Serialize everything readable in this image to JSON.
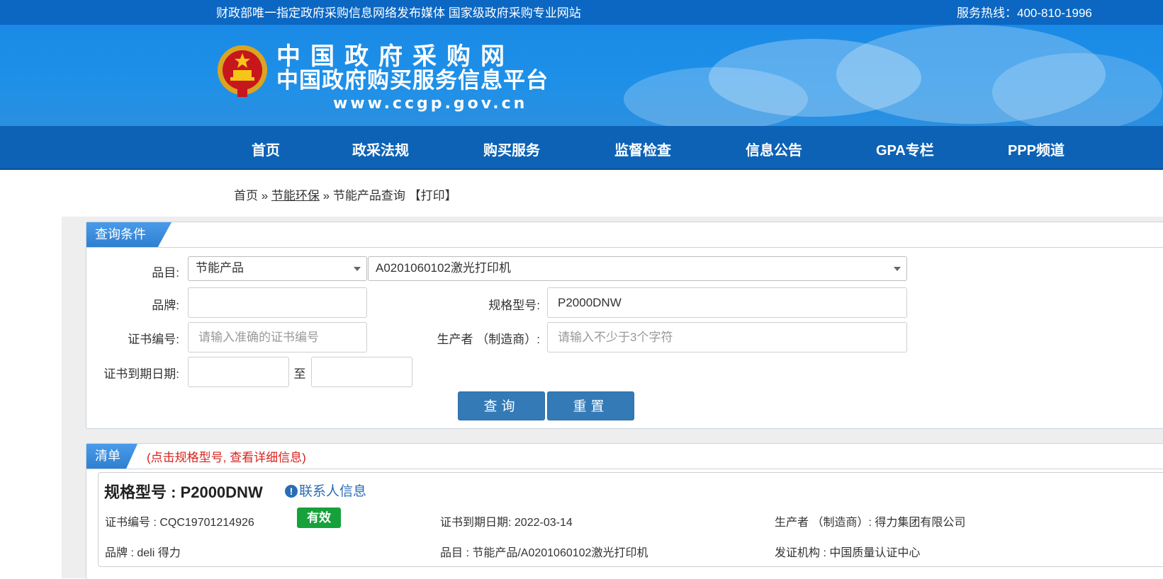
{
  "topbar": {
    "slogan": "财政部唯一指定政府采购信息网络发布媒体 国家级政府采购专业网站",
    "hotline": "服务热线：400-810-1996"
  },
  "banner": {
    "title_line1": "中国政府采购网",
    "title_line2": "中国政府购买服务信息平台",
    "url": "www.ccgp.gov.cn",
    "emblem_icon": "national-emblem-icon"
  },
  "nav": {
    "items": [
      {
        "label": "首页"
      },
      {
        "label": "政采法规"
      },
      {
        "label": "购买服务"
      },
      {
        "label": "监督检查"
      },
      {
        "label": "信息公告"
      },
      {
        "label": "GPA专栏"
      },
      {
        "label": "PPP频道"
      }
    ]
  },
  "breadcrumb": {
    "home": "首页",
    "sep1": "»",
    "section": "节能环保",
    "sep2": "»",
    "page": "节能产品查询",
    "print": "【打印】"
  },
  "query": {
    "tab": "查询条件",
    "category_label": "品目:",
    "category_value": "节能产品",
    "subcategory_value": "A0201060102激光打印机",
    "brand_label": "品牌:",
    "brand_value": "",
    "model_label": "规格型号:",
    "model_value": "P2000DNW",
    "cert_label": "证书编号:",
    "cert_placeholder": "请输入准确的证书编号",
    "maker_label": "生产者 （制造商）:",
    "maker_placeholder": "请输入不少于3个字符",
    "expiry_label": "证书到期日期:",
    "to_label": "至",
    "search_button": "查询",
    "reset_button": "重置"
  },
  "results": {
    "tab": "清单",
    "hint": "(点击规格型号, 查看详细信息)",
    "records": [
      {
        "model": "规格型号 : P2000DNW",
        "contact": "联系人信息",
        "cert": "证书编号 : CQC19701214926",
        "status": "有效",
        "expiry": "证书到期日期: 2022-03-14",
        "maker": "生产者 （制造商）: 得力集团有限公司",
        "brand": "品牌 : deli 得力",
        "category": "品目 : 节能产品/A0201060102激光打印机",
        "issuer": "发证机构 : 中国质量认证中心"
      }
    ]
  },
  "colors": {
    "topbar": "#0b67c2",
    "nav": "#0d62b5",
    "button": "#337ab7",
    "status_valid": "#17a13b",
    "hint": "#d9221c",
    "link": "#2a6cb5"
  }
}
